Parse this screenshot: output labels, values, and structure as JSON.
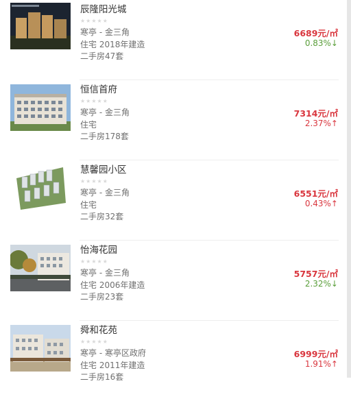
{
  "listings": [
    {
      "name": "辰隆阳光城",
      "rating_stars": "★★★★★",
      "location": "寒亭 - 金三角",
      "type_year": "住宅 2018年建造",
      "second_hand": "二手房47套",
      "price": "6689元/㎡",
      "change": "0.83%↓",
      "trend": "down",
      "photo": "night-building-photo"
    },
    {
      "name": "恒信首府",
      "rating_stars": "★★★★★",
      "location": "寒亭 - 金三角",
      "type_year": "住宅",
      "second_hand": "二手房178套",
      "price": "7314元/㎡",
      "change": "2.37%↑",
      "trend": "up",
      "photo": "apartment-building-photo"
    },
    {
      "name": "慧馨园小区",
      "rating_stars": "★★★★★",
      "location": "寒亭 - 金三角",
      "type_year": "住宅",
      "second_hand": "二手房32套",
      "price": "6551元/㎡",
      "change": "0.43%↑",
      "trend": "up",
      "photo": "aerial-render-photo"
    },
    {
      "name": "怡海花园",
      "rating_stars": "★★★★★",
      "location": "寒亭 - 金三角",
      "type_year": "住宅 2006年建造",
      "second_hand": "二手房23套",
      "price": "5757元/㎡",
      "change": "2.32%↓",
      "trend": "down",
      "photo": "street-view-photo"
    },
    {
      "name": "舜和花苑",
      "rating_stars": "★★★★★",
      "location": "寒亭 - 寒亭区政府",
      "type_year": "住宅 2011年建造",
      "second_hand": "二手房16套",
      "price": "6999元/㎡",
      "change": "1.91%↑",
      "trend": "up",
      "photo": "residential-block-photo"
    }
  ],
  "colors": {
    "price": "#d9363e",
    "up": "#d9363e",
    "down": "#5a9e3a",
    "muted": "#6f6f6f"
  }
}
